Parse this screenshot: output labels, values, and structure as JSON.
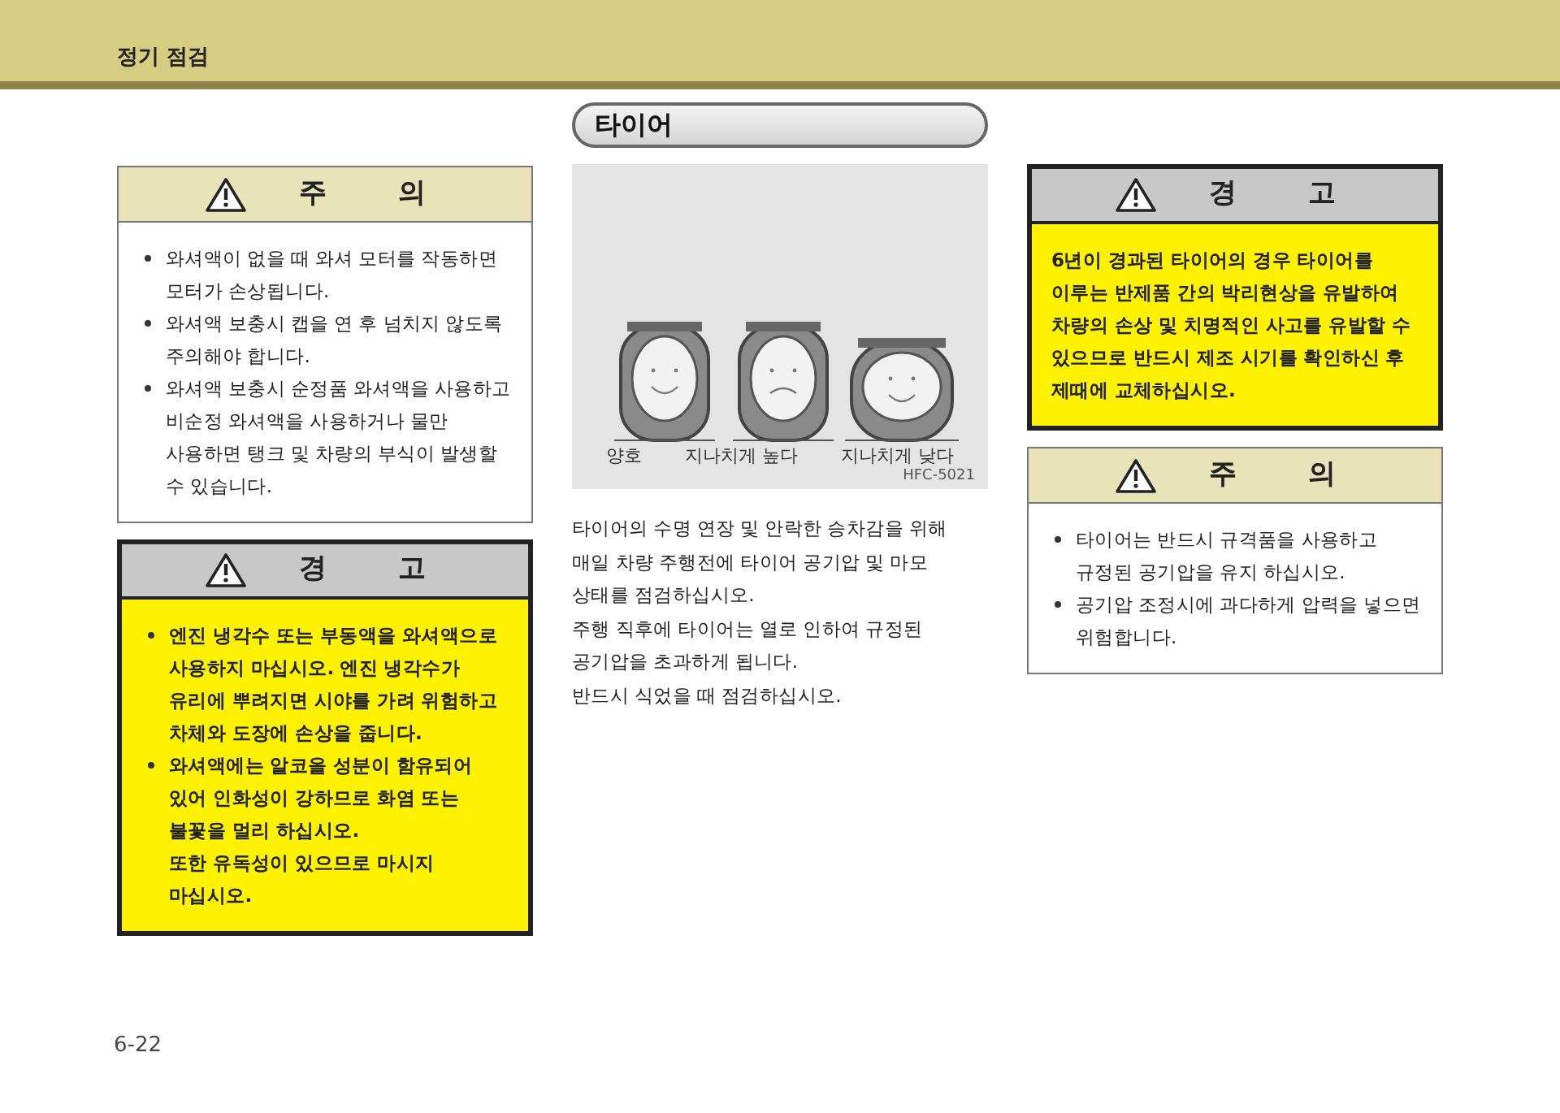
{
  "header": {
    "title": "정기 점검"
  },
  "left_notices": [
    {
      "kind": "caution",
      "title": [
        "주",
        "의"
      ],
      "items": [
        {
          "kind": "bullet",
          "text": "와셔액이 없을 때 와셔 모터를 작동하면 모터가 손상됩니다."
        },
        {
          "kind": "bullet",
          "text": "와셔액 보충시 캡을 연 후 넘치지 않도록 주의해야 합니다."
        },
        {
          "kind": "bullet",
          "text": "와셔액 보충시 순정품 와셔액을 사용하고 비순정 와셔액을 사용하거나 물만 사용하면 탱크 및 차량의 부식이 발생할 수 있습니다."
        }
      ]
    },
    {
      "kind": "warning",
      "title": [
        "경",
        "고"
      ],
      "items": [
        {
          "kind": "bullet",
          "text": "엔진 냉각수 또는 부동액을 와셔액으로 사용하지 마십시오. 엔진 냉각수가 유리에 뿌려지면 시야를 가려 위험하고 차체와 도장에 손상을 줍니다."
        },
        {
          "kind": "bullet",
          "text": "와셔액에는 알코올 성분이 함유되어 있어 인화성이 강하므로 화염 또는 불꽃을 멀리 하십시오."
        },
        {
          "kind": "plain",
          "text": "또한 유독성이 있으므로 마시지 마십시오."
        }
      ]
    }
  ],
  "section": {
    "title": "타이어",
    "figure": {
      "labels": [
        "양호",
        "지나치게 높다",
        "지나치게 낮다"
      ],
      "code": "HFC-5021"
    },
    "paragraphs": [
      "타이어의 수명 연장 및 안락한 승차감을 위해 매일 차량 주행전에 타이어 공기압 및 마모 상태를 점검하십시오.",
      "주행 직후에 타이어는 열로 인하여 규정된 공기압을 초과하게 됩니다.",
      "반드시 식었을 때 점검하십시오."
    ]
  },
  "right_notices": [
    {
      "kind": "warning",
      "title": [
        "경",
        "고"
      ],
      "items": [
        {
          "kind": "plain",
          "text": "6년이 경과된 타이어의 경우 타이어를 이루는 반제품 간의 박리현상을 유발하여 차량의 손상 및 치명적인 사고를 유발할 수 있으므로 반드시 제조 시기를 확인하신 후 제때에 교체하십시오."
        }
      ]
    },
    {
      "kind": "caution",
      "title": [
        "주",
        "의"
      ],
      "items": [
        {
          "kind": "bullet",
          "text": "타이어는 반드시 규격품을 사용하고 규정된 공기압을 유지 하십시오."
        },
        {
          "kind": "bullet",
          "text": "공기압 조정시에 과다하게 압력을 넣으면 위험합니다."
        }
      ]
    }
  ],
  "footer": {
    "page": "6-22"
  }
}
